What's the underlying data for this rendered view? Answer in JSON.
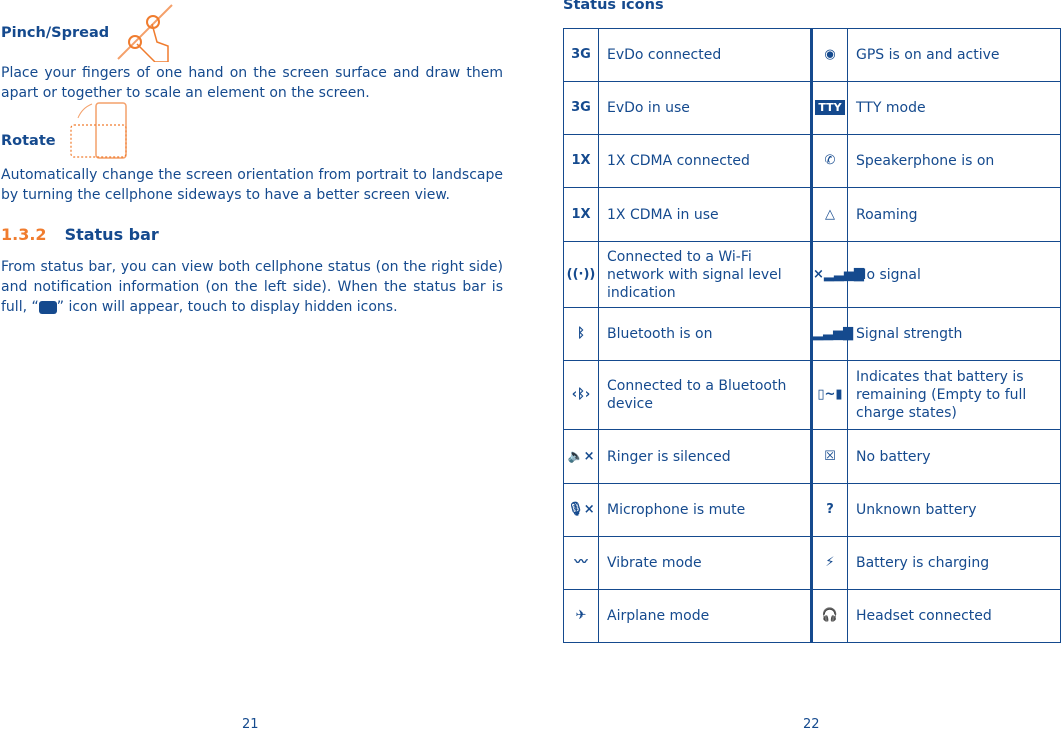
{
  "left_page": {
    "pinch_title": "Pinch/Spread",
    "pinch_text": "Place your fingers of one hand on the screen surface and draw them apart or together to scale an element on the screen.",
    "rotate_title": "Rotate",
    "rotate_text": "Automatically change the screen orientation from portrait to landscape by turning the cellphone sideways to have a better screen view.",
    "section_number": "1.3.2",
    "section_title": "Status bar",
    "status_text_1": "From status bar, you can view both cellphone status (on the right side) and notification information (on the left side). When the status bar is full, “",
    "status_text_2": "” icon will appear, touch to display hidden icons.",
    "page_number": "21"
  },
  "right_page": {
    "title": "Status icons",
    "page_number": "22",
    "rows": [
      {
        "left_icon": "3g-connected-icon",
        "left_glyph": "3G",
        "left": "EvDo connected",
        "right_icon": "gps-icon",
        "right_glyph": "◉",
        "right": "GPS is on and active"
      },
      {
        "left_icon": "3g-in-use-icon",
        "left_glyph": "3G",
        "left": "EvDo in use",
        "right_icon": "tty-icon",
        "right_glyph": "TTY",
        "right": "TTY mode"
      },
      {
        "left_icon": "1x-connected-icon",
        "left_glyph": "1X",
        "left": "1X CDMA connected",
        "right_icon": "speakerphone-icon",
        "right_glyph": "✆",
        "right": "Speakerphone is on"
      },
      {
        "left_icon": "1x-in-use-icon",
        "left_glyph": "1X",
        "left": "1X CDMA in use",
        "right_icon": "roaming-icon",
        "right_glyph": "△",
        "right": "Roaming"
      },
      {
        "left_icon": "wifi-icon",
        "left_glyph": "((·))",
        "left": "Connected to a Wi-Fi network with signal level indication",
        "right_icon": "no-signal-icon",
        "right_glyph": "×▂▃▅▇",
        "right": "No signal"
      },
      {
        "left_icon": "bluetooth-icon",
        "left_glyph": "ᛒ",
        "left": "Bluetooth is on",
        "right_icon": "signal-strength-icon",
        "right_glyph": "▂▃▅▇",
        "right": "Signal strength"
      },
      {
        "left_icon": "bluetooth-connected-icon",
        "left_glyph": "‹ᛒ›",
        "left": "Connected to a Bluetooth device",
        "right_icon": "battery-levels-icon",
        "right_glyph": "▯~▮",
        "right": "Indicates that battery is remaining (Empty to full charge states)"
      },
      {
        "left_icon": "ringer-silenced-icon",
        "left_glyph": "🔈×",
        "left": "Ringer is silenced",
        "right_icon": "no-battery-icon",
        "right_glyph": "☒",
        "right": "No battery"
      },
      {
        "left_icon": "microphone-mute-icon",
        "left_glyph": "🎙×",
        "left": "Microphone is mute",
        "right_icon": "unknown-battery-icon",
        "right_glyph": "?",
        "right": "Unknown battery"
      },
      {
        "left_icon": "vibrate-icon",
        "left_glyph": "〰",
        "left": "Vibrate mode",
        "right_icon": "battery-charging-icon",
        "right_glyph": "⚡",
        "right": "Battery is charging"
      },
      {
        "left_icon": "airplane-icon",
        "left_glyph": "✈",
        "left": "Airplane mode",
        "right_icon": "headset-icon",
        "right_glyph": "🎧",
        "right": "Headset connected"
      }
    ]
  },
  "colors": {
    "text": "#154a8e",
    "accent": "#f07c2e"
  }
}
